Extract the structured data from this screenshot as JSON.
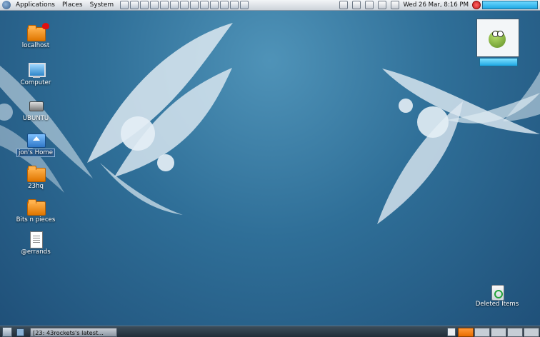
{
  "top_panel": {
    "menus": [
      "Applications",
      "Places",
      "System"
    ],
    "clock": "Wed 26 Mar,  8:16 PM"
  },
  "desktop_icons": [
    {
      "label": "localhost",
      "type": "folder-network"
    },
    {
      "label": "Computer",
      "type": "computer"
    },
    {
      "label": "UBUNTU",
      "type": "usb-drive"
    },
    {
      "label": "jon's Home",
      "type": "home-folder",
      "selected": true
    },
    {
      "label": "23hq",
      "type": "folder"
    },
    {
      "label": "Bits n pieces",
      "type": "folder"
    },
    {
      "label": "@errands",
      "type": "text-file"
    }
  ],
  "trash": {
    "label": "Deleted Items"
  },
  "taskbar": {
    "task_label": "[23: 43rockets's latest..."
  },
  "colors": {
    "panel_highlight": "#1ea8e4",
    "workspace_active": "#e86d00",
    "desktop_base": "#2f6f98"
  }
}
